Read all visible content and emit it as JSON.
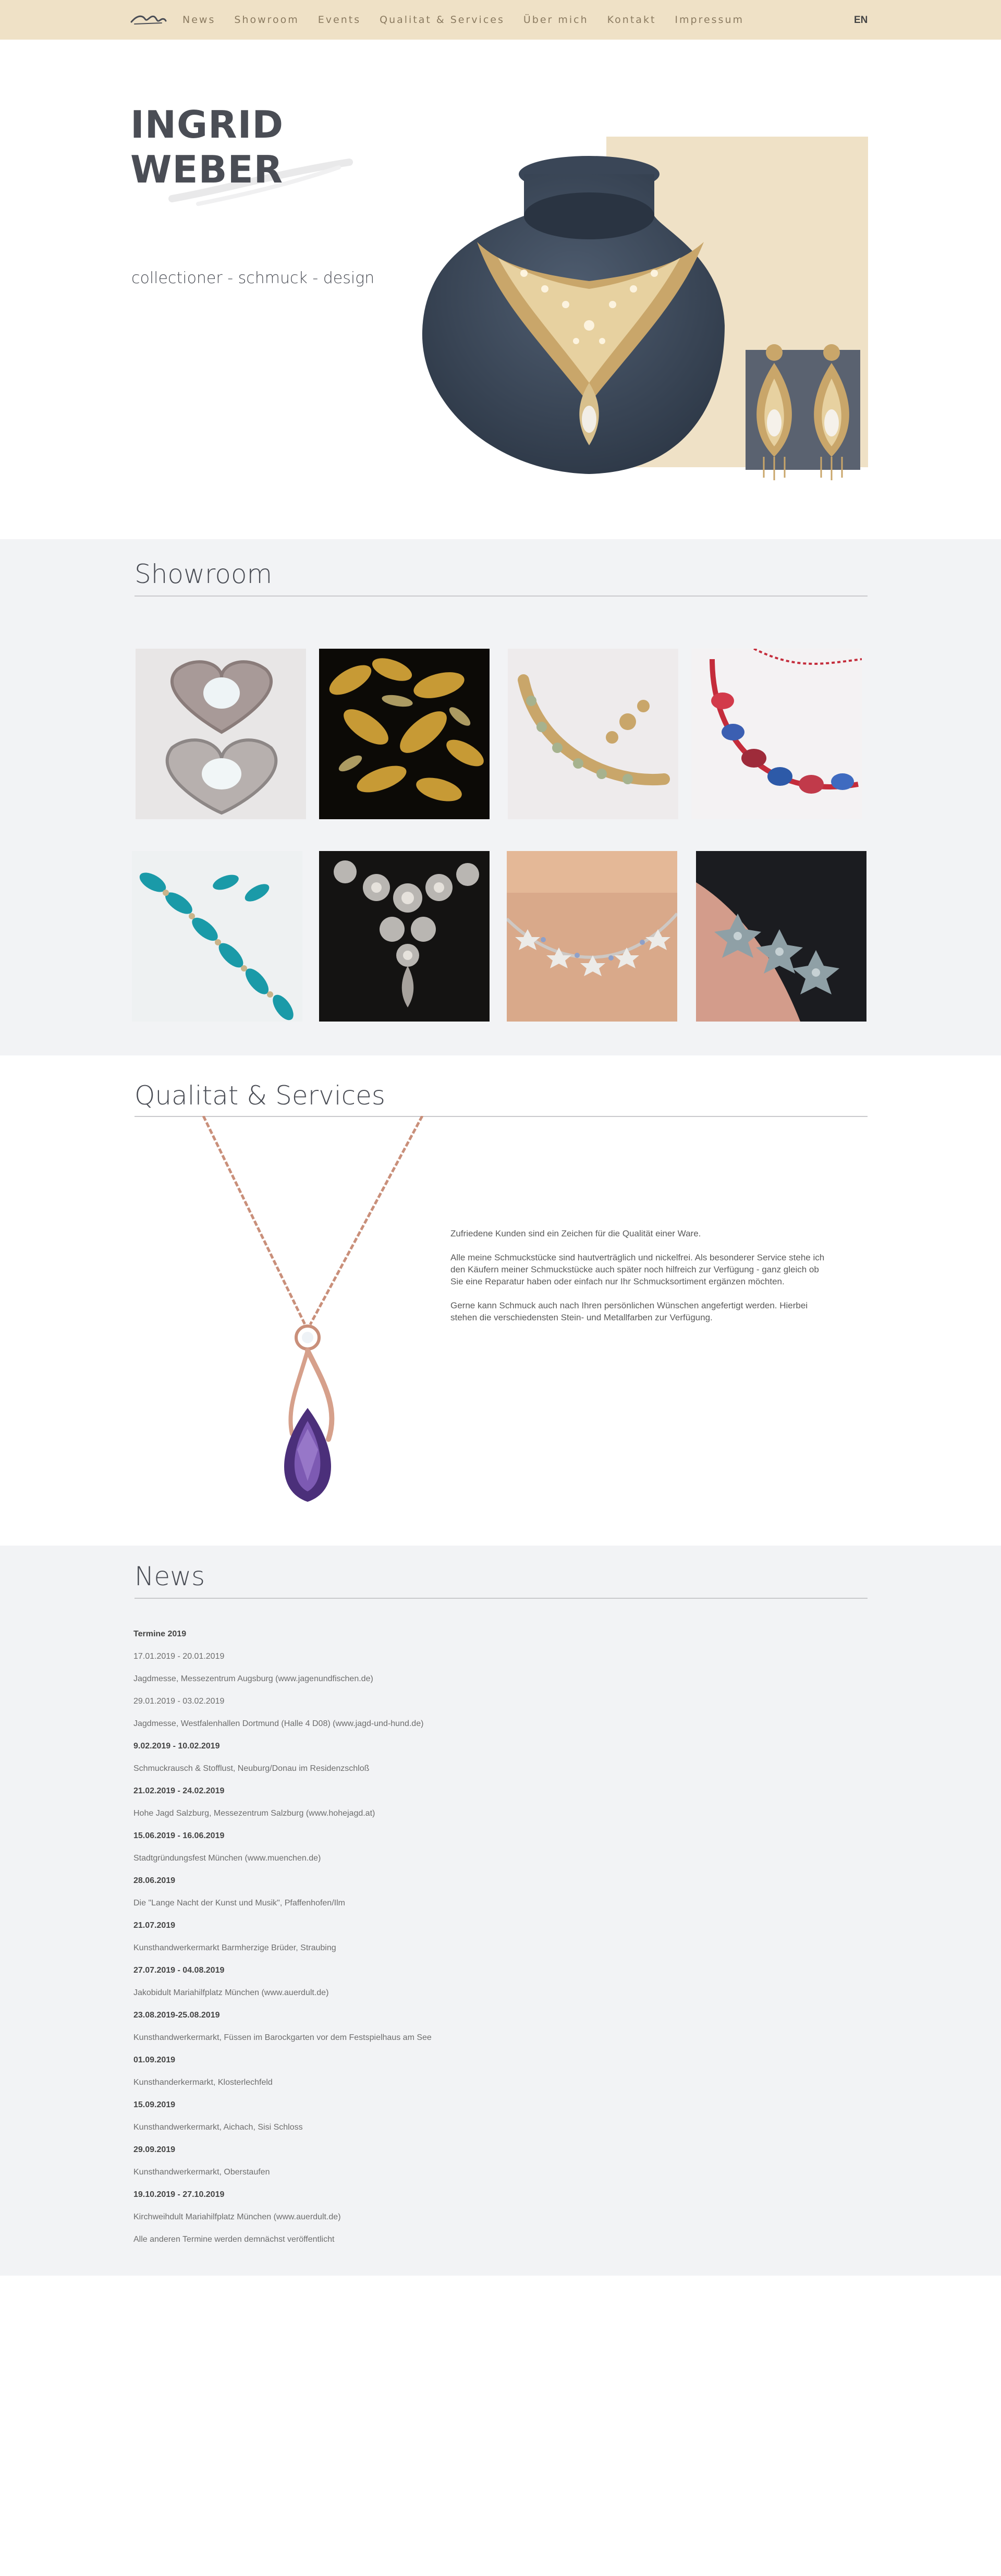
{
  "nav": {
    "logo_icon": "signature-logo-icon",
    "items": [
      "News",
      "Showroom",
      "Events",
      "Qualitat & Services",
      "Über mich",
      "Kontakt",
      "Impressum"
    ],
    "lang": "EN"
  },
  "hero": {
    "name_line1": "INGRID",
    "name_line2": "WEBER",
    "tagline": "collectioner - schmuck - design"
  },
  "showroom": {
    "title": "Showroom"
  },
  "qual": {
    "title": "Qualitat & Services",
    "p1": "Zufriedene Kunden sind ein Zeichen für die Qualität einer Ware.",
    "p2": "Alle meine Schmuckstücke sind hautverträglich und nickelfrei. Als besonderer Service stehe ich den Käufern meiner Schmuckstücke auch später noch hilfreich zur Verfügung - ganz gleich ob Sie eine Reparatur haben oder einfach nur Ihr Schmucksortiment ergänzen möchten.",
    "p3": "Gerne kann Schmuck auch nach Ihren persönlichen Wünschen angefertigt werden. Hierbei stehen die verschiedensten Stein- und Metallfarben zur Verfügung."
  },
  "news": {
    "title": "News",
    "rows": [
      {
        "text": "Termine 2019",
        "bold": true
      },
      {
        "text": "17.01.2019 - 20.01.2019",
        "bold": false
      },
      {
        "text": "Jagdmesse, Messezentrum Augsburg (www.jagenundfischen.de)",
        "bold": false
      },
      {
        "text": "29.01.2019 - 03.02.2019",
        "bold": false
      },
      {
        "text": "Jagdmesse, Westfalenhallen Dortmund (Halle 4 D08) (www.jagd-und-hund.de)",
        "bold": false
      },
      {
        "text": "9.02.2019 - 10.02.2019",
        "bold": true
      },
      {
        "text": "Schmuckrausch & Stofflust, Neuburg/Donau im Residenzschloß",
        "bold": false
      },
      {
        "text": "21.02.2019 - 24.02.2019",
        "bold": true
      },
      {
        "text": "Hohe Jagd Salzburg, Messezentrum Salzburg (www.hohejagd.at)",
        "bold": false
      },
      {
        "text": "15.06.2019 - 16.06.2019",
        "bold": true
      },
      {
        "text": "Stadtgründungsfest München (www.muenchen.de)",
        "bold": false
      },
      {
        "text": "28.06.2019",
        "bold": true
      },
      {
        "text": "Die \"Lange Nacht der Kunst und Musik\", Pfaffenhofen/Ilm",
        "bold": false
      },
      {
        "text": "21.07.2019",
        "bold": true
      },
      {
        "text": "Kunsthandwerkermarkt Barmherzige Brüder, Straubing",
        "bold": false
      },
      {
        "text": "27.07.2019 - 04.08.2019",
        "bold": true
      },
      {
        "text": "Jakobidult Mariahilfplatz München (www.auerdult.de)",
        "bold": false
      },
      {
        "text": "23.08.2019-25.08.2019",
        "bold": true
      },
      {
        "text": "Kunsthandwerkermarkt, Füssen im Barockgarten vor dem Festspielhaus am See",
        "bold": false
      },
      {
        "text": "01.09.2019",
        "bold": true
      },
      {
        "text": "Kunsthanderkermarkt, Klosterlechfeld",
        "bold": false
      },
      {
        "text": "15.09.2019",
        "bold": true
      },
      {
        "text": "Kunsthandwerkermarkt, Aichach, Sisi Schloss",
        "bold": false
      },
      {
        "text": "29.09.2019",
        "bold": true
      },
      {
        "text": "Kunsthandwerkermarkt, Oberstaufen",
        "bold": false
      },
      {
        "text": "19.10.2019 - 27.10.2019",
        "bold": true
      },
      {
        "text": "Kirchweihdult Mariahilfplatz München (www.auerdult.de)",
        "bold": false
      },
      {
        "text": "Alle anderen Termine werden demnächst veröffentlicht",
        "bold": false
      }
    ]
  },
  "colors": {
    "nav_bg": "#efe1c6",
    "section_bg": "#f2f3f5",
    "heading": "#4a4d55"
  }
}
